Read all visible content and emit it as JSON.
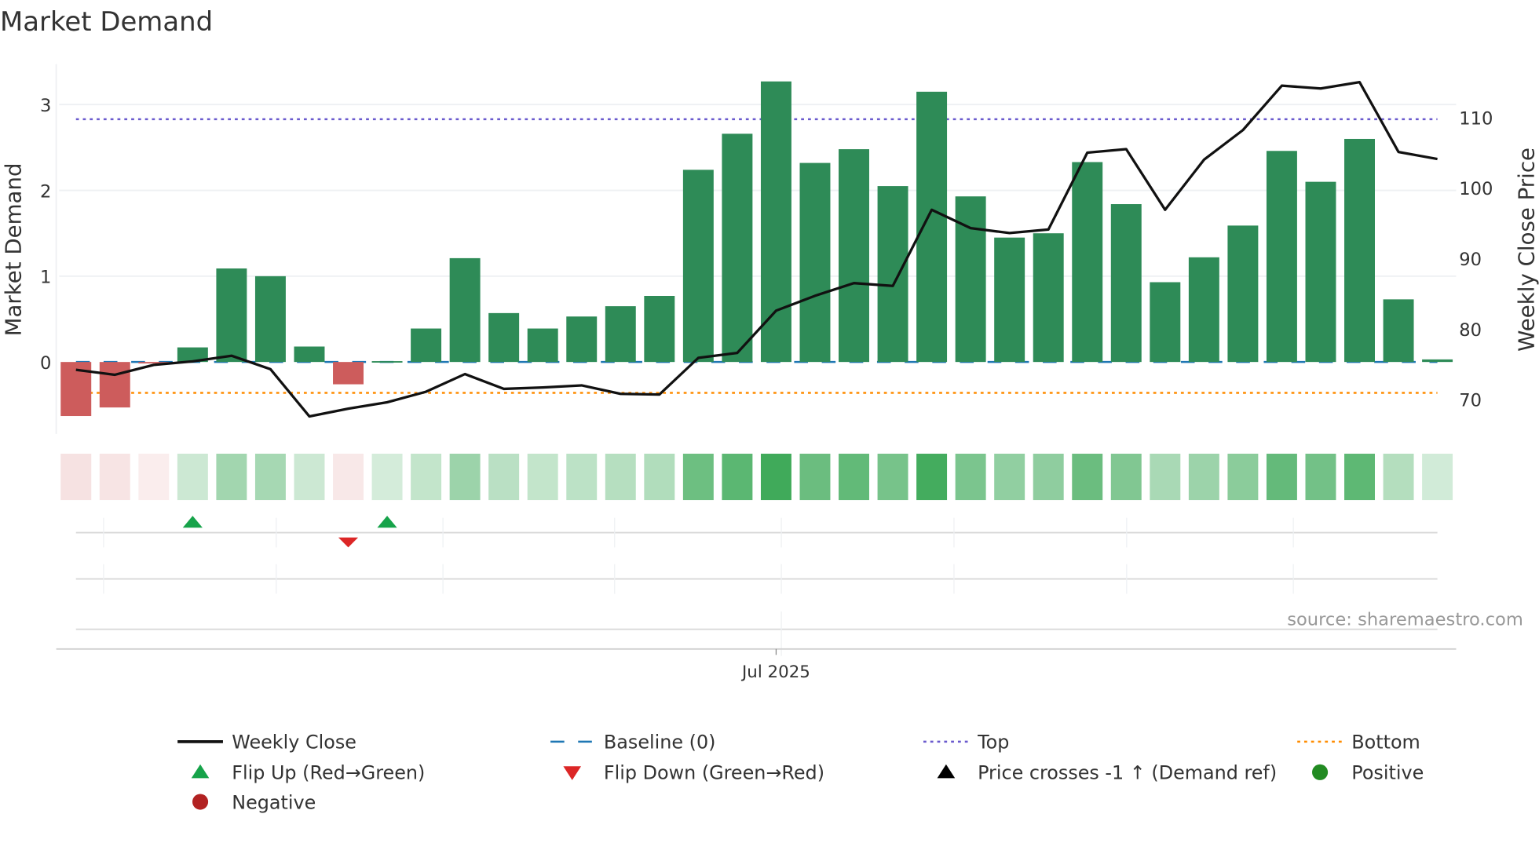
{
  "chart_data": {
    "type": "bar",
    "title": "Market Demand",
    "ylabel": "Market Demand",
    "y2label": "Weekly Close Price",
    "ylim": [
      -0.85,
      3.5
    ],
    "y2lim": [
      61,
      122
    ],
    "yticks": [
      0,
      1,
      2,
      3
    ],
    "y2ticks": [
      70,
      80,
      90,
      100,
      110
    ],
    "xticks": [
      {
        "index": 18,
        "label": "Jul 2025"
      }
    ],
    "grid": true,
    "legend_placement": "bottom",
    "series": [
      {
        "name": "Market Demand",
        "type": "bar",
        "values": [
          -0.63,
          -0.53,
          -0.01,
          0.17,
          1.09,
          1.0,
          0.18,
          -0.26,
          0.01,
          0.39,
          1.21,
          0.57,
          0.39,
          0.53,
          0.65,
          0.77,
          2.24,
          2.66,
          3.27,
          2.32,
          2.48,
          2.05,
          3.15,
          1.93,
          1.45,
          1.5,
          2.33,
          1.84,
          0.93,
          1.22,
          1.59,
          2.46,
          2.1,
          2.6,
          0.73,
          0.03
        ]
      },
      {
        "name": "Weekly Close",
        "type": "line",
        "axis": "right",
        "values": [
          74.2,
          73.5,
          74.9,
          75.4,
          76.2,
          74.3,
          67.6,
          68.7,
          69.6,
          71.1,
          73.6,
          71.5,
          71.7,
          72.0,
          70.8,
          70.7,
          75.9,
          76.6,
          82.6,
          84.7,
          86.5,
          86.1,
          96.9,
          94.3,
          93.6,
          94.1,
          105.0,
          105.5,
          96.9,
          104.0,
          108.2,
          114.5,
          114.1,
          115.0,
          105.1,
          104.1
        ]
      },
      {
        "name": "Baseline (0)",
        "type": "hline",
        "value": 0
      },
      {
        "name": "Top",
        "type": "hline",
        "value": 2.83
      },
      {
        "name": "Bottom",
        "type": "hline",
        "value": -0.36
      }
    ],
    "flip_up_indices": [
      3,
      8
    ],
    "flip_down_indices": [
      7
    ],
    "colors": {
      "positive_bar": "#2e8b57",
      "negative_bar": "#cd5c5c",
      "line": "#111111",
      "baseline": "#1f77b4",
      "top": "#6a5acd",
      "bottom": "#ff8c00",
      "flip_up": "#16a34a",
      "flip_down": "#dc2626",
      "positive_dot": "#228b22",
      "negative_dot": "#b22222"
    },
    "source": "source: sharemaestro.com",
    "legend": [
      {
        "label": "Weekly Close",
        "symbol": "line"
      },
      {
        "label": "Baseline (0)",
        "symbol": "dash"
      },
      {
        "label": "Top",
        "symbol": "dot-top"
      },
      {
        "label": "Bottom",
        "symbol": "dot-bottom"
      },
      {
        "label": "Flip Up (Red→Green)",
        "symbol": "tri-up-green"
      },
      {
        "label": "Flip Down (Green→Red)",
        "symbol": "tri-down-red"
      },
      {
        "label": "Price crosses -1 ↑ (Demand ref)",
        "symbol": "tri-up-black"
      },
      {
        "label": "Positive",
        "symbol": "circle-green"
      },
      {
        "label": "Negative",
        "symbol": "circle-red"
      }
    ]
  }
}
